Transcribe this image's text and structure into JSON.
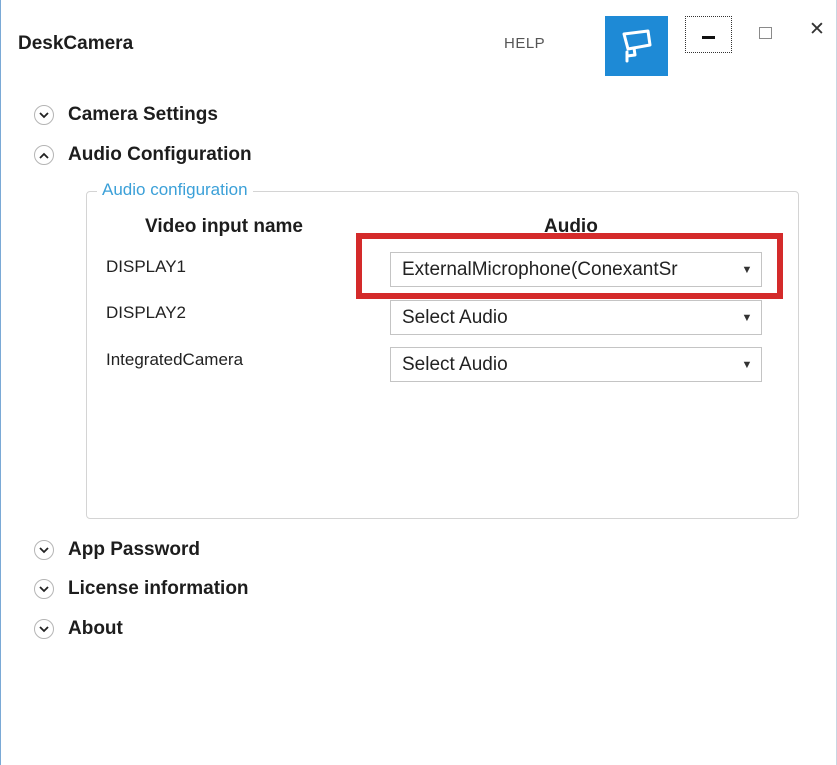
{
  "window": {
    "title": "DeskCamera",
    "help_label": "HELP"
  },
  "sections": {
    "camera_settings": "Camera Settings",
    "audio_configuration": "Audio Configuration",
    "app_password": "App Password",
    "license_information": "License information",
    "about": "About"
  },
  "audio_group": {
    "legend": "Audio configuration",
    "col_video": "Video input name",
    "col_audio": "Audio",
    "rows": [
      {
        "input": "DISPLAY1",
        "audio": "ExternalMicrophone(ConexantSr"
      },
      {
        "input": "DISPLAY2",
        "audio": "Select Audio"
      },
      {
        "input": "IntegratedCamera",
        "audio": "Select Audio"
      }
    ]
  },
  "colors": {
    "accent": "#1e8ad6",
    "legend": "#3ba0d8",
    "highlight": "#d42a2a"
  },
  "icons": [
    "camera-icon",
    "minimize-icon",
    "maximize-icon",
    "close-icon",
    "chevron-down-icon",
    "chevron-up-icon",
    "dropdown-arrow-icon"
  ]
}
